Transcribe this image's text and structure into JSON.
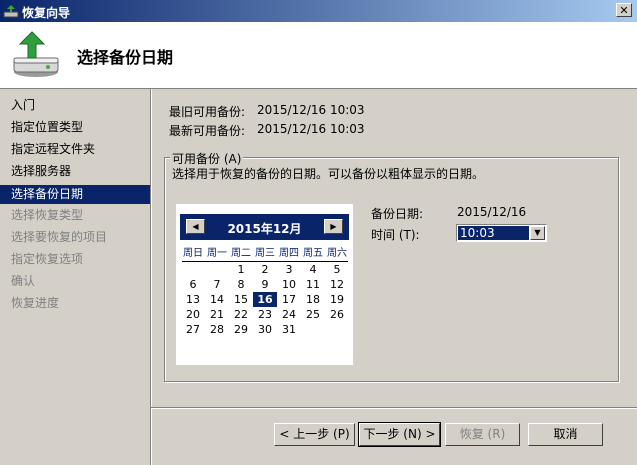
{
  "window": {
    "title": "恢复向导",
    "close_label": "✕"
  },
  "header": {
    "title": "选择备份日期"
  },
  "nav": {
    "items": [
      {
        "label": "入门",
        "state": "done"
      },
      {
        "label": "指定位置类型",
        "state": "done"
      },
      {
        "label": "指定远程文件夹",
        "state": "done"
      },
      {
        "label": "选择服务器",
        "state": "done"
      },
      {
        "label": "选择备份日期",
        "state": "selected"
      },
      {
        "label": "选择恢复类型",
        "state": "disabled"
      },
      {
        "label": "选择要恢复的项目",
        "state": "disabled"
      },
      {
        "label": "指定恢复选项",
        "state": "disabled"
      },
      {
        "label": "确认",
        "state": "disabled"
      },
      {
        "label": "恢复进度",
        "state": "disabled"
      }
    ]
  },
  "info": {
    "oldest_label": "最旧可用备份:",
    "oldest_value": "2015/12/16 10:03",
    "newest_label": "最新可用备份:",
    "newest_value": "2015/12/16 10:03"
  },
  "group": {
    "label": "可用备份 (A)",
    "description": "选择用于恢复的备份的日期。可以备份以粗体显示的日期。"
  },
  "calendar": {
    "month_label": "2015年12月",
    "prev_label": "◀",
    "next_label": "▶",
    "weekdays": [
      "周日",
      "周一",
      "周二",
      "周三",
      "周四",
      "周五",
      "周六"
    ],
    "weeks": [
      [
        "",
        "",
        "1",
        "2",
        "3",
        "4",
        "5"
      ],
      [
        "6",
        "7",
        "8",
        "9",
        "10",
        "11",
        "12"
      ],
      [
        "13",
        "14",
        "15",
        "16",
        "17",
        "18",
        "19"
      ],
      [
        "20",
        "21",
        "22",
        "23",
        "24",
        "25",
        "26"
      ],
      [
        "27",
        "28",
        "29",
        "30",
        "31",
        "",
        ""
      ]
    ],
    "selected_day": "16"
  },
  "backup": {
    "date_label": "备份日期:",
    "date_value": "2015/12/16",
    "time_label": "时间 (T):",
    "time_value": "10:03",
    "arrow": "▼"
  },
  "buttons": {
    "back": "< 上一步 (P)",
    "next": "下一步 (N) >",
    "restore": "恢复 (R)",
    "cancel": "取消"
  }
}
